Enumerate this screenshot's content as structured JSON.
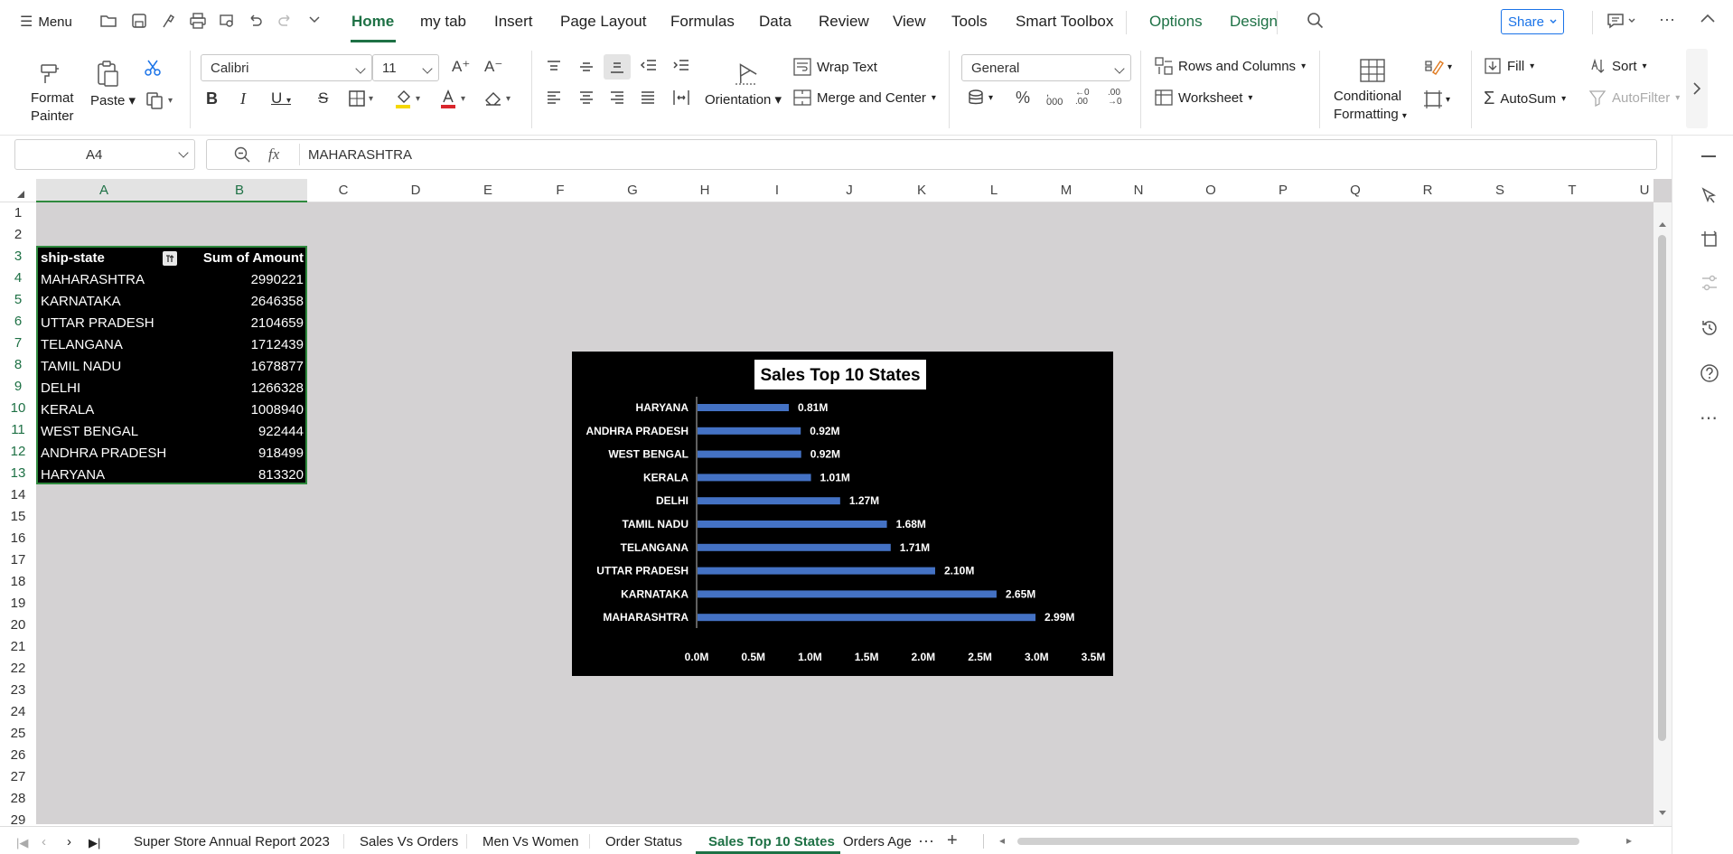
{
  "menubar": {
    "menu_label": "Menu",
    "tabs": [
      "Home",
      "my tab",
      "Insert",
      "Page Layout",
      "Formulas",
      "Data",
      "Review",
      "View",
      "Tools",
      "Smart Toolbox",
      "Options",
      "Design"
    ],
    "share_label": "Share"
  },
  "ribbon": {
    "format_painter_1": "Format",
    "format_painter_2": "Painter",
    "paste": "Paste",
    "font_name": "Calibri",
    "font_size": "11",
    "wrap_text": "Wrap Text",
    "merge_center": "Merge and Center",
    "orientation": "Orientation",
    "number_format": "General",
    "rows_columns": "Rows and Columns",
    "worksheet": "Worksheet",
    "conditional_1": "Conditional",
    "conditional_2": "Formatting",
    "fill": "Fill",
    "sort": "Sort",
    "autosum": "AutoSum",
    "autofilter": "AutoFilter"
  },
  "formula_bar": {
    "name_box": "A4",
    "fx": "fx",
    "content": "MAHARASHTRA"
  },
  "grid": {
    "columns": [
      "A",
      "B",
      "C",
      "D",
      "E",
      "F",
      "G",
      "H",
      "I",
      "J",
      "K",
      "L",
      "M",
      "N",
      "O",
      "P",
      "Q",
      "R",
      "S",
      "T",
      "U"
    ],
    "rows": [
      "1",
      "2",
      "3",
      "4",
      "5",
      "6",
      "7",
      "8",
      "9",
      "10",
      "11",
      "12",
      "13",
      "14",
      "15",
      "16",
      "17",
      "18",
      "19",
      "20",
      "21",
      "22",
      "23",
      "24",
      "25",
      "26",
      "27",
      "28",
      "29"
    ]
  },
  "pivot": {
    "header_a": "ship-state",
    "header_b": "Sum of Amount",
    "rows": [
      {
        "state": "MAHARASHTRA",
        "amount": "2990221"
      },
      {
        "state": "KARNATAKA",
        "amount": "2646358"
      },
      {
        "state": "UTTAR PRADESH",
        "amount": "2104659"
      },
      {
        "state": "TELANGANA",
        "amount": "1712439"
      },
      {
        "state": "TAMIL NADU",
        "amount": "1678877"
      },
      {
        "state": "DELHI",
        "amount": "1266328"
      },
      {
        "state": "KERALA",
        "amount": "1008940"
      },
      {
        "state": "WEST BENGAL",
        "amount": "922444"
      },
      {
        "state": "ANDHRA PRADESH",
        "amount": "918499"
      },
      {
        "state": "HARYANA",
        "amount": "813320"
      }
    ]
  },
  "chart_data": {
    "type": "bar",
    "orientation": "horizontal",
    "title": "Sales Top 10 States",
    "categories": [
      "HARYANA",
      "ANDHRA PRADESH",
      "WEST BENGAL",
      "KERALA",
      "DELHI",
      "TAMIL NADU",
      "TELANGANA",
      "UTTAR PRADESH",
      "KARNATAKA",
      "MAHARASHTRA"
    ],
    "values": [
      813320,
      918499,
      922444,
      1008940,
      1266328,
      1678877,
      1712439,
      2104659,
      2646358,
      2990221
    ],
    "data_labels": [
      "0.81M",
      "0.92M",
      "0.92M",
      "1.01M",
      "1.27M",
      "1.68M",
      "1.71M",
      "2.10M",
      "2.65M",
      "2.99M"
    ],
    "xlim": [
      0,
      3500000
    ],
    "x_ticks": [
      "0.0M",
      "0.5M",
      "1.0M",
      "1.5M",
      "2.0M",
      "2.5M",
      "3.0M",
      "3.5M"
    ],
    "bar_color": "#4472c4",
    "background": "#000000",
    "grid": false
  },
  "sheet_tabs": {
    "tabs": [
      "Super Store Annual Report 2023",
      "Sales Vs Orders",
      "Men Vs Women",
      "Order Status",
      "Sales Top 10 States",
      "Orders Age"
    ],
    "active": "Sales Top 10 States"
  },
  "colors": {
    "accent": "#1e7145",
    "share": "#1a73e8",
    "selection": "#2f8a3e",
    "sheet_bg": "#d4d2d3"
  }
}
